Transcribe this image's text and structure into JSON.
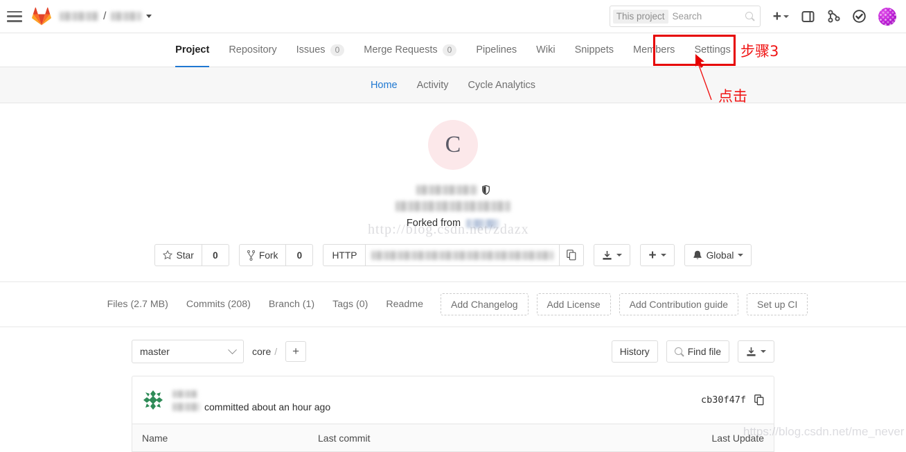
{
  "topbar": {
    "menu_icon": "hamburger-menu-icon",
    "logo_icon": "gitlab-logo-icon",
    "breadcrumb_separator": "/",
    "search": {
      "scope_label": "This project",
      "placeholder": "Search",
      "icon": "search-icon"
    },
    "icons": [
      {
        "name": "plus-dropdown-icon",
        "glyph": "+"
      },
      {
        "name": "issues-icon"
      },
      {
        "name": "merge-requests-icon"
      },
      {
        "name": "todos-checkmark-icon"
      },
      {
        "name": "user-avatar"
      }
    ]
  },
  "nav_tabs": [
    {
      "label": "Project",
      "badge": null,
      "active": true
    },
    {
      "label": "Repository",
      "badge": null,
      "active": false
    },
    {
      "label": "Issues",
      "badge": "0",
      "active": false
    },
    {
      "label": "Merge Requests",
      "badge": "0",
      "active": false
    },
    {
      "label": "Pipelines",
      "badge": null,
      "active": false
    },
    {
      "label": "Wiki",
      "badge": null,
      "active": false
    },
    {
      "label": "Snippets",
      "badge": null,
      "active": false
    },
    {
      "label": "Members",
      "badge": null,
      "active": false
    },
    {
      "label": "Settings",
      "badge": null,
      "active": false
    }
  ],
  "annotations": {
    "highlight_color": "#e60000",
    "step_label": "步骤3",
    "click_label": "点击"
  },
  "subnav": [
    {
      "label": "Home",
      "active": true
    },
    {
      "label": "Activity",
      "active": false
    },
    {
      "label": "Cycle Analytics",
      "active": false
    }
  ],
  "project": {
    "avatar_initial": "C",
    "avatar_bg": "#fce8ea",
    "visibility_icon": "shield-icon",
    "forked_from_label": "Forked from"
  },
  "actions": {
    "star_label": "Star",
    "star_count": "0",
    "star_icon": "star-icon",
    "fork_label": "Fork",
    "fork_count": "0",
    "fork_icon": "fork-icon",
    "clone_protocol": "HTTP",
    "copy_icon": "copy-icon",
    "download_icon": "download-icon",
    "plus_icon": "plus-icon",
    "notification_icon": "bell-icon",
    "notification_label": "Global"
  },
  "stats": [
    "Files (2.7 MB)",
    "Commits (208)",
    "Branch (1)",
    "Tags (0)",
    "Readme"
  ],
  "suggest_buttons": [
    "Add Changelog",
    "Add License",
    "Add Contribution guide",
    "Set up CI"
  ],
  "file_browser": {
    "branch": "master",
    "path_segment": "core",
    "path_separator": "/",
    "add_icon": "plus-icon",
    "history_label": "History",
    "find_file_label": "Find file",
    "find_file_icon": "search-icon",
    "download_icon": "download-icon",
    "commit": {
      "avatar_icon": "identicon-avatar",
      "message_suffix": "committed about an hour ago",
      "sha": "cb30f47f",
      "copy_icon": "copy-icon"
    },
    "table_headers": {
      "name": "Name",
      "last_commit": "Last commit",
      "last_update": "Last Update"
    }
  },
  "watermarks": {
    "center": "http://blog.csdn.net/zdazx",
    "corner": "https://blog.csdn.net/me_never"
  }
}
